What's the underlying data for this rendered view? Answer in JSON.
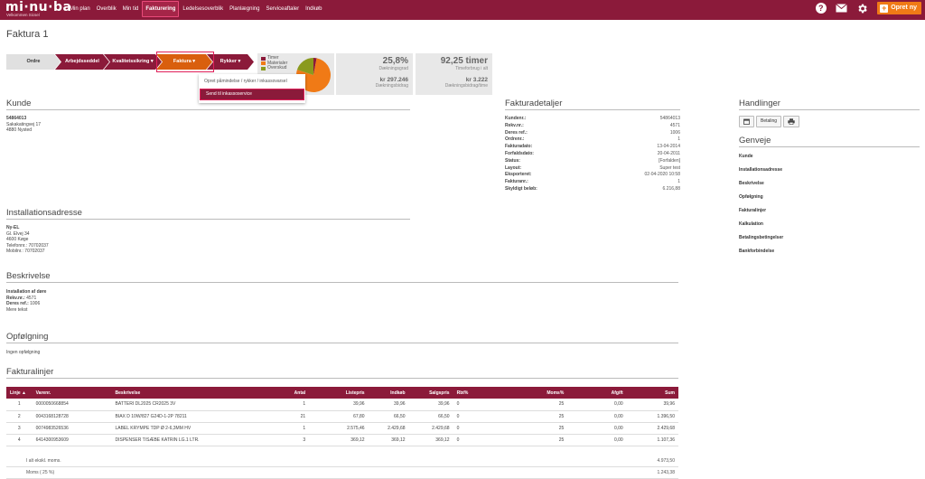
{
  "app": {
    "logo": "mi·nu·ba",
    "logo_sub": "Velkommen Sicsel",
    "nav": [
      "Min plan",
      "Overblik",
      "Min tid",
      "Fakturering",
      "Ledelsesoverblik",
      "Planlægning",
      "Serviceaftaler",
      "Indkøb"
    ],
    "active_nav": "Fakturering",
    "new_button": "Opret ny"
  },
  "page": {
    "title": "Faktura 1"
  },
  "flow": {
    "steps": [
      "Ordre",
      "Arbejdsseddel",
      "Kvalitetssikring ▾",
      "Faktura ▾",
      "Rykker ▾"
    ]
  },
  "dropdown": {
    "items": [
      "Opret påmindelse / rykker / inkassovarsel",
      "Send til inkassoservice"
    ]
  },
  "chart": {
    "legend": [
      "Timer",
      "Materialer",
      "Overskud"
    ],
    "colors": [
      "#8b1a3a",
      "#f07a16",
      "#8a9a1e"
    ],
    "values": [
      3,
      77,
      20
    ]
  },
  "kpis": [
    {
      "big": "25,8%",
      "small": "Dækningsgrad",
      "val": "kr 297.246",
      "val_label": "Dækningsbidrag"
    },
    {
      "big": "92,25 timer",
      "small": "Timeforbrug i alt",
      "val": "kr 3.222",
      "val_label": "Dækningsbidrag/time"
    }
  ],
  "kunde": {
    "heading": "Kunde",
    "number": "54864013",
    "address": "Sakakatingvej 17",
    "city": "4880   Nysted"
  },
  "faktura": {
    "heading": "Fakturadetaljer",
    "rows": [
      {
        "k": "Kundenr.:",
        "v": "54864013"
      },
      {
        "k": "Rekv.nr.:",
        "v": "4571"
      },
      {
        "k": "Deres ref.:",
        "v": "1006"
      },
      {
        "k": "Ordrenr.:",
        "v": "1"
      },
      {
        "k": "Fakturadato:",
        "v": "13-04-2014"
      },
      {
        "k": "Forfaldsdato:",
        "v": "20-04-2011"
      },
      {
        "k": "Status:",
        "v": "[Forfalden]"
      },
      {
        "k": "Layout:",
        "v": "Super test"
      },
      {
        "k": "Eksporteret:",
        "v": "02-04-2020 10:58"
      },
      {
        "k": "Fakturanr.:",
        "v": "1"
      },
      {
        "k": "Skyldigt beløb:",
        "v": "6.216,88"
      }
    ]
  },
  "handlinger": {
    "heading": "Handlinger",
    "betaling": "Betaling"
  },
  "genveje": {
    "heading": "Genveje",
    "links": [
      "Kunde",
      "Installationsadresse",
      "Beskrivelse",
      "Opfølgning",
      "Fakturalinjer",
      "Kalkulation",
      "Betalingsbetingelser",
      "Bankforbindelse"
    ]
  },
  "installation": {
    "heading": "Installationsadresse",
    "name": "Ny-EL",
    "address": "Gl. Elvej 34",
    "city": "4600   Køge",
    "phone": "Telefonnr.: 70702037",
    "mobile": "Mobilnr.: 70702037"
  },
  "beskrivelse": {
    "heading": "Beskrivelse",
    "title": "Installation af døre",
    "rekv_label": "Rekv.nr.:",
    "rekv": "4571",
    "ref_label": "Deres ref.:",
    "ref": "1006",
    "more": "Mere tekst"
  },
  "opfolgning": {
    "heading": "Opfølgning",
    "text": "Ingen opfølgning"
  },
  "fakturalinjer": {
    "heading": "Fakturalinjer",
    "columns": [
      "Linje ▲",
      "Varenr.",
      "Beskrivelse",
      "Antal",
      "Listepris",
      "Indkøb",
      "Salgspris",
      "Rbt%",
      "Moms%",
      "Afgift",
      "Sum"
    ],
    "rows": [
      [
        "1",
        "0000050668854",
        "BATTERI DL2025 CR2025 3V",
        "1",
        "39,96",
        "39,96",
        "39,96",
        "0",
        "25",
        "0,00",
        "39,96"
      ],
      [
        "2",
        "0043168128728",
        "BIAX D 10W/827 G24D-1-2P 78211",
        "21",
        "67,80",
        "66,50",
        "66,50",
        "0",
        "25",
        "0,00",
        "1.396,50"
      ],
      [
        "3",
        "0074983526536",
        "LABEL KRYMPE TDP Ø 2-6,3MM HV",
        "1",
        "2.575,46",
        "2.429,68",
        "2.429,68",
        "0",
        "25",
        "0,00",
        "2.429,68"
      ],
      [
        "4",
        "6414300953609",
        "DISPENSER T/SÆBE KATRIN LG.1 LTR.",
        "3",
        "369,12",
        "369,12",
        "369,12",
        "0",
        "25",
        "0,00",
        "1.107,36"
      ]
    ],
    "total_label": "I alt ekskl. moms.",
    "total": "4.973,50",
    "moms_label": "Moms ( 25 %)",
    "moms": "1.243,38"
  }
}
